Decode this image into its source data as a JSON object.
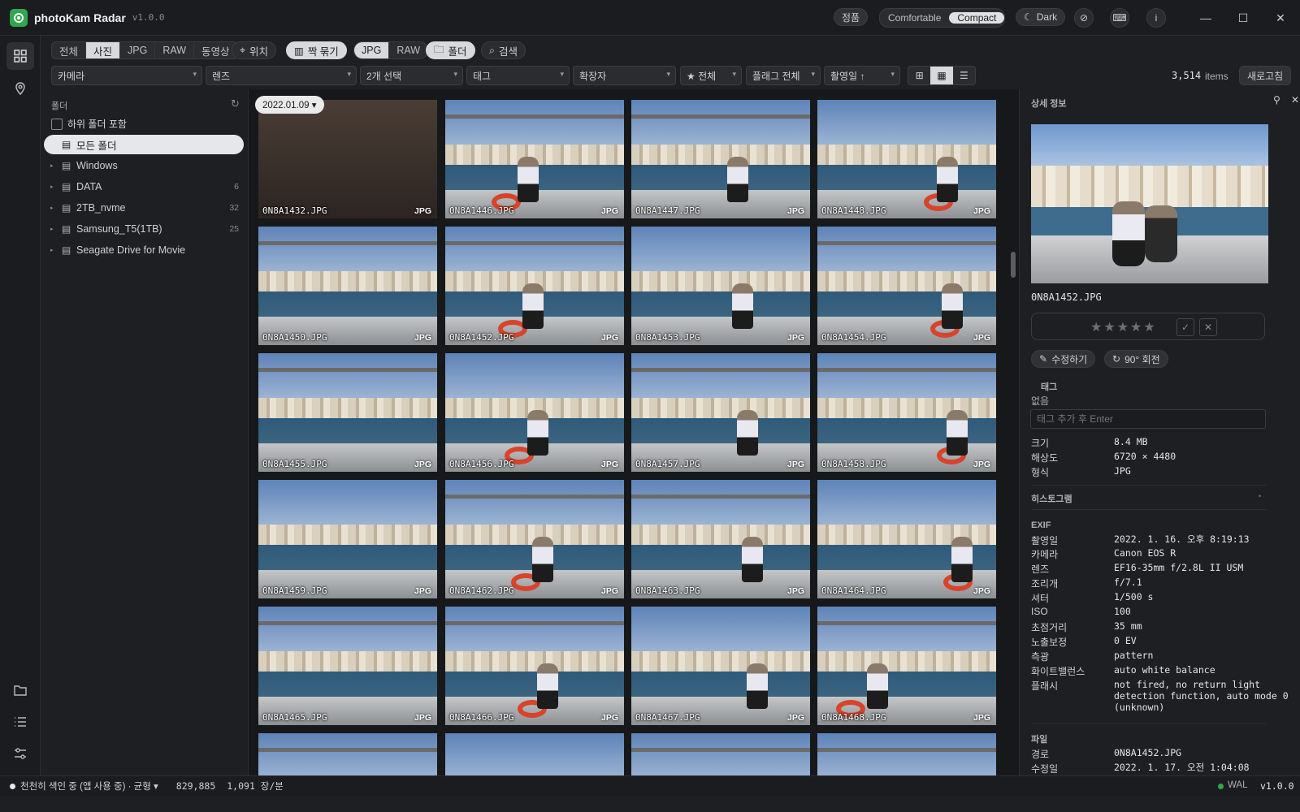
{
  "app": {
    "name": "photoKam Radar",
    "version": "v1.0.0"
  },
  "titlebar": {
    "genuine": "정품",
    "density_options": [
      "Comfortable",
      "Compact"
    ],
    "density_selected": "Compact",
    "theme_label": "Dark"
  },
  "toolbar": {
    "media_filter": [
      "전체",
      "사진",
      "JPG",
      "RAW",
      "동영상"
    ],
    "media_selected": "사진",
    "location_label": "위치",
    "pair_label": "짝 묶기",
    "format_toggle": [
      "JPG",
      "RAW"
    ],
    "format_selected": "JPG",
    "folder_label": "폴더",
    "search_label": "검색"
  },
  "filters": {
    "camera": "카메라",
    "lens": "렌즈",
    "selection": "2개 선택",
    "tag": "태그",
    "extension": "확장자",
    "rating": "★ 전체",
    "flag": "플래그 전체",
    "sort": "촬영일 ↑",
    "item_count": "3,514",
    "items_label": "items",
    "refresh_label": "새로고침"
  },
  "folders": {
    "header": "폴더",
    "include_sub": "하위 폴더 포함",
    "items": [
      {
        "label": "모든 폴더",
        "count": "",
        "selected": true
      },
      {
        "label": "Windows",
        "count": ""
      },
      {
        "label": "DATA",
        "count": "6"
      },
      {
        "label": "2TB_nvme",
        "count": "32"
      },
      {
        "label": "Samsung_T5(1TB)",
        "count": "25"
      },
      {
        "label": "Seagate Drive for Movie",
        "count": ""
      }
    ]
  },
  "grid": {
    "date_chip": "2022.01.09 ▾",
    "thumbnails": [
      {
        "name": "0N8A1432.JPG",
        "type": "JPG"
      },
      {
        "name": "0N8A1446.JPG",
        "type": "JPG"
      },
      {
        "name": "0N8A1447.JPG",
        "type": "JPG"
      },
      {
        "name": "0N8A1448.JPG",
        "type": "JPG"
      },
      {
        "name": "0N8A1450.JPG",
        "type": "JPG"
      },
      {
        "name": "0N8A1452.JPG",
        "type": "JPG"
      },
      {
        "name": "0N8A1453.JPG",
        "type": "JPG"
      },
      {
        "name": "0N8A1454.JPG",
        "type": "JPG"
      },
      {
        "name": "0N8A1455.JPG",
        "type": "JPG"
      },
      {
        "name": "0N8A1456.JPG",
        "type": "JPG"
      },
      {
        "name": "0N8A1457.JPG",
        "type": "JPG"
      },
      {
        "name": "0N8A1458.JPG",
        "type": "JPG"
      },
      {
        "name": "0N8A1459.JPG",
        "type": "JPG"
      },
      {
        "name": "0N8A1462.JPG",
        "type": "JPG"
      },
      {
        "name": "0N8A1463.JPG",
        "type": "JPG"
      },
      {
        "name": "0N8A1464.JPG",
        "type": "JPG"
      },
      {
        "name": "0N8A1465.JPG",
        "type": "JPG"
      },
      {
        "name": "0N8A1466.JPG",
        "type": "JPG"
      },
      {
        "name": "0N8A1467.JPG",
        "type": "JPG"
      },
      {
        "name": "0N8A1468.JPG",
        "type": "JPG"
      }
    ]
  },
  "detail": {
    "header": "상세 정보",
    "filename": "0N8A1452.JPG",
    "stars": "★★★★★",
    "edit_label": "수정하기",
    "rotate_label": "90° 회전",
    "tag_header": "태그",
    "tag_none": "없음",
    "tag_placeholder": "태그 추가 후 Enter",
    "basic": [
      {
        "k": "크기",
        "v": "8.4 MB"
      },
      {
        "k": "해상도",
        "v": "6720 × 4480"
      },
      {
        "k": "형식",
        "v": "JPG"
      }
    ],
    "histogram_header": "히스토그램",
    "exif_header": "EXIF",
    "exif": [
      {
        "k": "촬영일",
        "v": "2022. 1. 16. 오후 8:19:13"
      },
      {
        "k": "카메라",
        "v": "Canon EOS R"
      },
      {
        "k": "렌즈",
        "v": "EF16-35mm f/2.8L II USM"
      },
      {
        "k": "조리개",
        "v": "f/7.1"
      },
      {
        "k": "셔터",
        "v": "1/500 s"
      },
      {
        "k": "ISO",
        "v": "100"
      },
      {
        "k": "초점거리",
        "v": "35 mm"
      },
      {
        "k": "노출보정",
        "v": "0 EV"
      },
      {
        "k": "측광",
        "v": "pattern"
      },
      {
        "k": "화이트밸런스",
        "v": "auto white balance"
      },
      {
        "k": "플래시",
        "v": "not fired, no return light detection function, auto mode 0 (unknown)"
      }
    ],
    "file_header": "파일",
    "file": [
      {
        "k": "경로",
        "v": "0N8A1452.JPG"
      },
      {
        "k": "수정일",
        "v": "2022. 1. 17. 오전 1:04:08"
      }
    ]
  },
  "status": {
    "indexing": "천천히 색인 중 (앱 사용 중) · 균형 ▾",
    "count1": "829,885",
    "rate": "1,091 장/분",
    "wal": "WAL",
    "version": "v1.0.0"
  },
  "colors": {
    "accent_green": "#2fa84f",
    "bg": "#1e1f22",
    "selected": "#e6e7e9"
  }
}
